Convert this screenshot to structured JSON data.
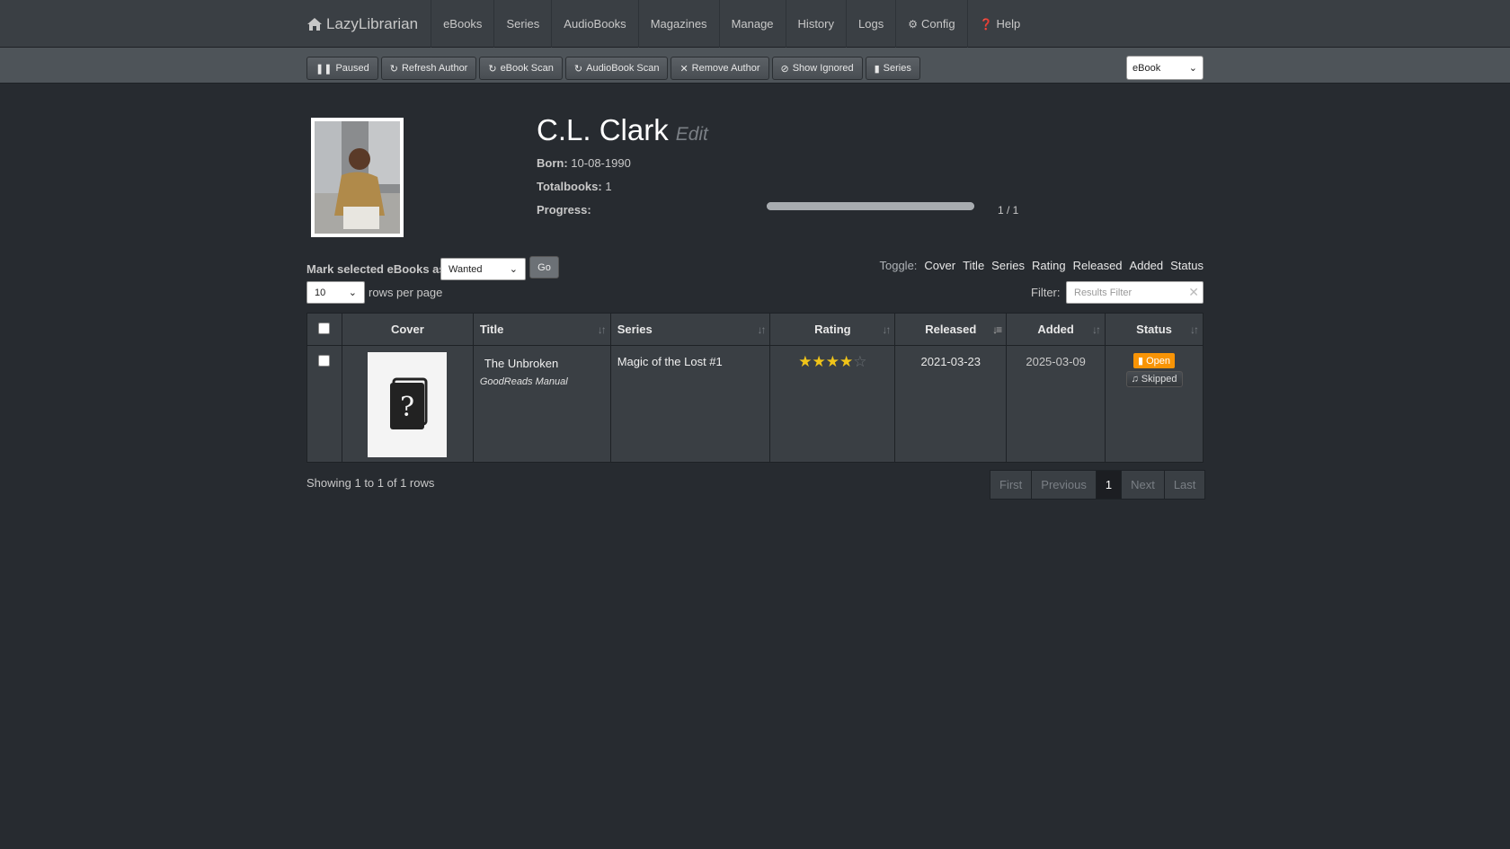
{
  "nav": {
    "brand": "LazyLibrarian",
    "items": [
      {
        "label": "eBooks"
      },
      {
        "label": "Series"
      },
      {
        "label": "AudioBooks"
      },
      {
        "label": "Magazines"
      },
      {
        "label": "Manage"
      },
      {
        "label": "History"
      },
      {
        "label": "Logs"
      },
      {
        "label": "Config",
        "icon": "gear-icon"
      },
      {
        "label": "Help",
        "icon": "question-circle-icon"
      }
    ]
  },
  "toolbar": {
    "paused": "Paused",
    "refresh_author": "Refresh Author",
    "ebook_scan": "eBook Scan",
    "audiobook_scan": "AudioBook Scan",
    "remove_author": "Remove Author",
    "show_ignored": "Show Ignored",
    "series": "Series",
    "type_select": "eBook"
  },
  "author": {
    "name": "C.L. Clark",
    "edit": "Edit",
    "born_label": "Born:",
    "born": "10-08-1990",
    "totalbooks_label": "Totalbooks:",
    "totalbooks": "1",
    "progress_label": "Progress:",
    "progress_text": "1 / 1",
    "progress_fraction": 1.0
  },
  "controls": {
    "mark_label": "Mark selected eBooks as",
    "mark_value": "Wanted",
    "go": "Go",
    "rows_value": "10",
    "rows_label": "rows per page",
    "toggle_label": "Toggle:",
    "toggles": [
      "Cover",
      "Title",
      "Series",
      "Rating",
      "Released",
      "Added",
      "Status"
    ],
    "filter_label": "Filter:",
    "filter_placeholder": "Results Filter"
  },
  "table": {
    "headers": {
      "cover": "Cover",
      "title": "Title",
      "series": "Series",
      "rating": "Rating",
      "released": "Released",
      "added": "Added",
      "status": "Status"
    },
    "rows": [
      {
        "title": "The Unbroken",
        "source": "GoodReads Manual",
        "series": "Magic of the Lost #1",
        "rating": 4,
        "rating_max": 5,
        "released": "2021-03-23",
        "added": "2025-03-09",
        "status_primary": "Open",
        "status_secondary": "Skipped"
      }
    ]
  },
  "footer": {
    "showing": "Showing 1 to 1 of 1 rows",
    "pager": {
      "first": "First",
      "previous": "Previous",
      "current": "1",
      "next": "Next",
      "last": "Last"
    }
  }
}
